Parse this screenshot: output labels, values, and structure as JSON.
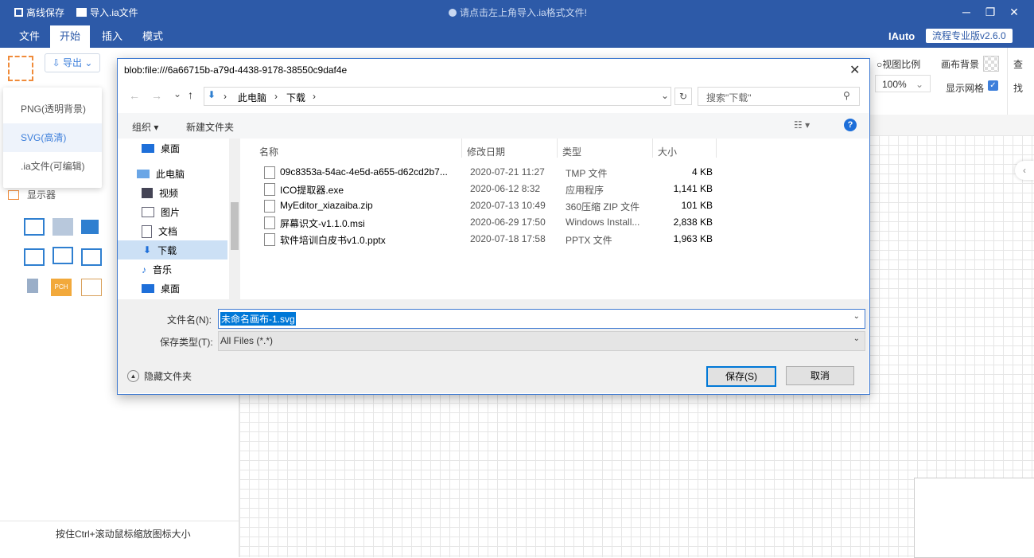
{
  "app": {
    "offline_save": "离线保存",
    "import_file": "导入.ia文件",
    "hint": "请点击左上角导入.ia格式文件!",
    "user": "IAuto",
    "version": "流程专业版v2.6.0"
  },
  "menu": [
    "文件",
    "开始",
    "插入",
    "模式"
  ],
  "toolbar": {
    "export_label": "导出",
    "view_ratio_label": "视图比例",
    "zoom_value": "100%",
    "canvas_bg_label": "画布背景",
    "show_grid_label": "显示网格",
    "find_label_1": "查",
    "find_label_2": "找"
  },
  "export_menu": [
    "PNG(透明背景)",
    "SVG(高清)",
    ".ia文件(可编辑)"
  ],
  "sidepanel": {
    "category": "显示器",
    "footer_hint": "按住Ctrl+滚动鼠标缩放图标大小"
  },
  "dialog": {
    "title": "blob:file:///6a66715b-a79d-4438-9178-38550c9daf4e",
    "breadcrumb": [
      "此电脑",
      "下载"
    ],
    "search_placeholder": "搜索\"下载\"",
    "organize": "组织",
    "new_folder": "新建文件夹",
    "nav": [
      "桌面",
      "此电脑",
      "视频",
      "图片",
      "文档",
      "下载",
      "音乐",
      "桌面"
    ],
    "columns": [
      "名称",
      "修改日期",
      "类型",
      "大小"
    ],
    "files": [
      {
        "name": "09c8353a-54ac-4e5d-a655-d62cd2b7...",
        "date": "2020-07-21 11:27",
        "type": "TMP 文件",
        "size": "4 KB"
      },
      {
        "name": "ICO提取器.exe",
        "date": "2020-06-12 8:32",
        "type": "应用程序",
        "size": "1,141 KB"
      },
      {
        "name": "MyEditor_xiazaiba.zip",
        "date": "2020-07-13 10:49",
        "type": "360压缩 ZIP 文件",
        "size": "101 KB"
      },
      {
        "name": "屏幕识文-v1.1.0.msi",
        "date": "2020-06-29 17:50",
        "type": "Windows Install...",
        "size": "2,838 KB"
      },
      {
        "name": "软件培训白皮书v1.0.pptx",
        "date": "2020-07-18 17:58",
        "type": "PPTX 文件",
        "size": "1,963 KB"
      }
    ],
    "filename_label": "文件名(N):",
    "filename_value": "未命名画布-1.svg",
    "filetype_label": "保存类型(T):",
    "filetype_value": "All Files (*.*)",
    "hide_folders": "隐藏文件夹",
    "save": "保存(S)",
    "cancel": "取消"
  },
  "colors": {
    "brand": "#2d5aa8",
    "accent": "#3d7fdb",
    "export_orange": "#f08b3a"
  }
}
